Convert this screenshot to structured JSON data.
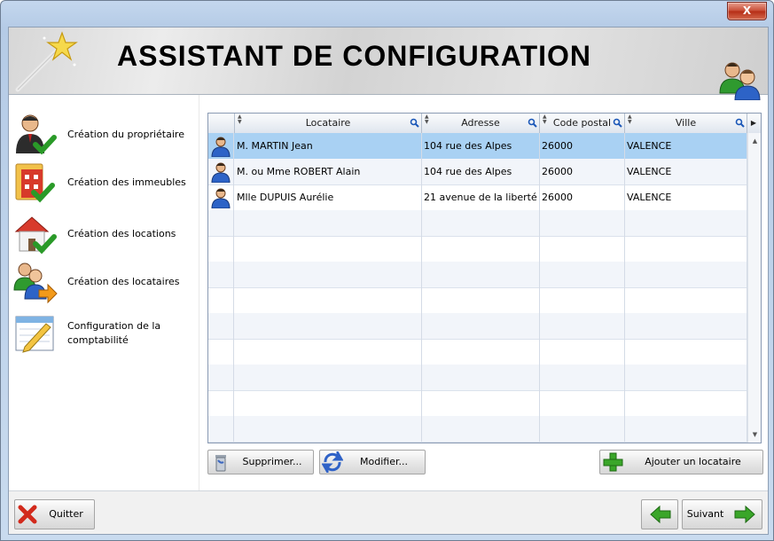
{
  "window": {
    "close_label": "X"
  },
  "header": {
    "title": "ASSISTANT DE CONFIGURATION"
  },
  "steps": [
    {
      "label": "Création du propriétaire",
      "icon": "user-check-icon"
    },
    {
      "label": "Création des immeubles",
      "icon": "building-folder-check-icon"
    },
    {
      "label": "Création des locations",
      "icon": "house-check-icon"
    },
    {
      "label": "Création des locataires",
      "icon": "users-arrow-icon"
    },
    {
      "label": "Configuration de la comptabilité",
      "icon": "notepad-pencil-icon"
    }
  ],
  "table": {
    "columns": [
      "Locataire",
      "Adresse",
      "Code postal",
      "Ville"
    ],
    "rows": [
      {
        "locataire": "M. MARTIN Jean",
        "adresse": "104 rue des Alpes",
        "code_postal": "26000",
        "ville": "VALENCE"
      },
      {
        "locataire": "M. ou Mme ROBERT Alain",
        "adresse": "104 rue des Alpes",
        "code_postal": "26000",
        "ville": "VALENCE"
      },
      {
        "locataire": "Mlle DUPUIS Aurélie",
        "adresse": "21 avenue de la liberté",
        "code_postal": "26000",
        "ville": "VALENCE"
      }
    ]
  },
  "actions": {
    "delete_label": "Supprimer...",
    "edit_label": "Modifier...",
    "add_label": "Ajouter un locataire"
  },
  "footer": {
    "quit_label": "Quitter",
    "next_label": "Suivant"
  },
  "colors": {
    "selected_row": "#a9d1f3",
    "accent_green": "#3aa629"
  }
}
